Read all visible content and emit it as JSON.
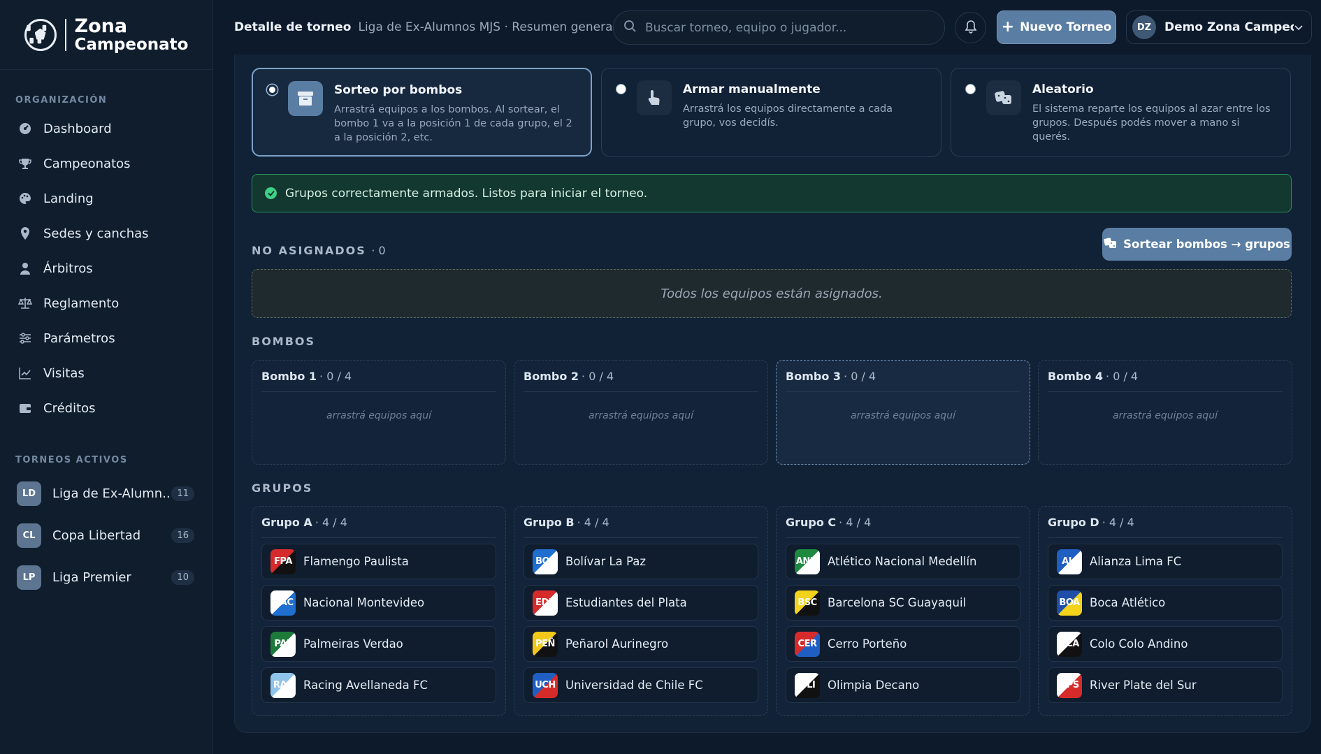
{
  "brand": {
    "line1": "Zona",
    "line2": "Campeonato"
  },
  "sidebar": {
    "section_org": "ORGANIZACIÓN",
    "items": [
      {
        "label": "Dashboard",
        "icon": "dashboard-icon"
      },
      {
        "label": "Campeonatos",
        "icon": "trophy-icon"
      },
      {
        "label": "Landing",
        "icon": "palette-icon"
      },
      {
        "label": "Sedes y canchas",
        "icon": "location-pin-icon"
      },
      {
        "label": "Árbitros",
        "icon": "referee-icon"
      },
      {
        "label": "Reglamento",
        "icon": "scale-icon"
      },
      {
        "label": "Parámetros",
        "icon": "sliders-icon"
      },
      {
        "label": "Visitas",
        "icon": "chart-line-icon"
      },
      {
        "label": "Créditos",
        "icon": "wallet-icon"
      }
    ],
    "section_active": "TORNEOS ACTIVOS",
    "tournaments": [
      {
        "badge": "LD",
        "name": "Liga de Ex-Alumn...",
        "count": "11"
      },
      {
        "badge": "CL",
        "name": "Copa Libertad",
        "count": "16"
      },
      {
        "badge": "LP",
        "name": "Liga Premier",
        "count": "10"
      }
    ]
  },
  "header": {
    "title": "Detalle de torneo",
    "subtitle": "Liga de Ex-Alumnos MJS · Resumen general",
    "search_placeholder": "Buscar torneo, equipo o jugador...",
    "new_button": "Nuevo Torneo",
    "user_initials": "DZ",
    "user_name": "Demo Zona Campeo..."
  },
  "modes": [
    {
      "title": "Sorteo por bombos",
      "desc": "Arrastrá equipos a los bombos. Al sortear, el bombo 1 va a la posición 1 de cada grupo, el 2 a la posición 2, etc.",
      "icon": "archive-box-icon",
      "selected": true
    },
    {
      "title": "Armar manualmente",
      "desc": "Arrastrá los equipos directamente a cada grupo, vos decidís.",
      "icon": "hand-pointer-icon",
      "selected": false
    },
    {
      "title": "Aleatorio",
      "desc": "El sistema reparte los equipos al azar entre los grupos. Después podés mover a mano si querés.",
      "icon": "dice-icon",
      "selected": false
    }
  ],
  "success_message": "Grupos correctamente armados. Listos para iniciar el torneo.",
  "unassigned": {
    "label": "NO ASIGNADOS",
    "count": "· 0",
    "empty_text": "Todos los equipos están asignados."
  },
  "draw_button": "Sortear bombos → grupos",
  "pots": {
    "label": "BOMBOS",
    "items": [
      {
        "name": "Bombo 1",
        "count": "· 0 / 4",
        "empty": "arrastrá equipos aquí"
      },
      {
        "name": "Bombo 2",
        "count": "· 0 / 4",
        "empty": "arrastrá equipos aquí"
      },
      {
        "name": "Bombo 3",
        "count": "· 0 / 4",
        "empty": "arrastrá equipos aquí"
      },
      {
        "name": "Bombo 4",
        "count": "· 0 / 4",
        "empty": "arrastrá equipos aquí"
      }
    ]
  },
  "groups": {
    "label": "GRUPOS",
    "items": [
      {
        "name": "Grupo A",
        "count": "· 4 / 4",
        "teams": [
          {
            "abbr": "FPA",
            "name": "Flamengo Paulista",
            "c1": "#d62b2b",
            "c2": "#111111"
          },
          {
            "abbr": "NAC",
            "name": "Nacional Montevideo",
            "c1": "#ffffff",
            "c2": "#1f6fd1"
          },
          {
            "abbr": "PAL",
            "name": "Palmeiras Verdao",
            "c1": "#1e7a3a",
            "c2": "#ffffff"
          },
          {
            "abbr": "RAC",
            "name": "Racing Avellaneda FC",
            "c1": "#8fc3ea",
            "c2": "#ffffff"
          }
        ]
      },
      {
        "name": "Grupo B",
        "count": "· 4 / 4",
        "teams": [
          {
            "abbr": "BOL",
            "name": "Bolívar La Paz",
            "c1": "#1f6fd1",
            "c2": "#ffffff"
          },
          {
            "abbr": "EDP",
            "name": "Estudiantes del Plata",
            "c1": "#d62b2b",
            "c2": "#ffffff"
          },
          {
            "abbr": "PEÑ",
            "name": "Peñarol Aurinegro",
            "c1": "#f2c81a",
            "c2": "#111111"
          },
          {
            "abbr": "UCH",
            "name": "Universidad de Chile FC",
            "c1": "#1f5fc4",
            "c2": "#d62b2b"
          }
        ]
      },
      {
        "name": "Grupo C",
        "count": "· 4 / 4",
        "teams": [
          {
            "abbr": "ANM",
            "name": "Atlético Nacional Medellín",
            "c1": "#1e8a3f",
            "c2": "#ffffff"
          },
          {
            "abbr": "BSC",
            "name": "Barcelona SC Guayaquil",
            "c1": "#f2d21a",
            "c2": "#111111"
          },
          {
            "abbr": "CER",
            "name": "Cerro Porteño",
            "c1": "#d62b2b",
            "c2": "#1f5fc4"
          },
          {
            "abbr": "OLI",
            "name": "Olimpia Decano",
            "c1": "#ffffff",
            "c2": "#111111"
          }
        ]
      },
      {
        "name": "Grupo D",
        "count": "· 4 / 4",
        "teams": [
          {
            "abbr": "ALI",
            "name": "Alianza Lima FC",
            "c1": "#1f5fc4",
            "c2": "#ffffff"
          },
          {
            "abbr": "BOA",
            "name": "Boca Atlético",
            "c1": "#1f4fa8",
            "c2": "#f2d21a"
          },
          {
            "abbr": "CCA",
            "name": "Colo Colo Andino",
            "c1": "#ffffff",
            "c2": "#111111"
          },
          {
            "abbr": "RPS",
            "name": "River Plate del Sur",
            "c1": "#ffffff",
            "c2": "#d62b2b"
          }
        ]
      }
    ]
  }
}
